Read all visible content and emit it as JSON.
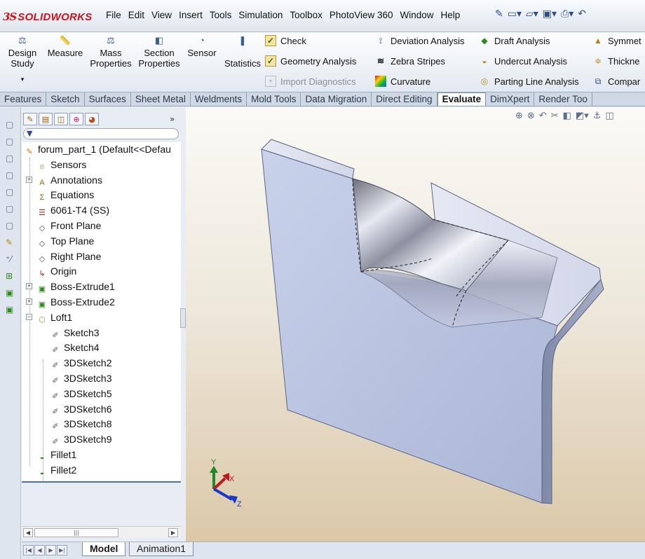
{
  "app": {
    "logo_mark": "3S",
    "logo_name": "SOLIDWORKS"
  },
  "menu": [
    "File",
    "Edit",
    "View",
    "Insert",
    "Tools",
    "Simulation",
    "Toolbox",
    "PhotoView 360",
    "Window",
    "Help"
  ],
  "ribbon": {
    "big_buttons": [
      {
        "label1": "Design",
        "label2": "Study",
        "icon": "design-study-icon"
      },
      {
        "label1": "Measure",
        "label2": "",
        "icon": "measure-icon"
      },
      {
        "label1": "Mass",
        "label2": "Properties",
        "icon": "mass-properties-icon"
      },
      {
        "label1": "Section",
        "label2": "Properties",
        "icon": "section-properties-icon"
      },
      {
        "label1": "Sensor",
        "label2": "",
        "icon": "sensor-icon"
      },
      {
        "label1": "Statistics",
        "label2": "",
        "icon": "statistics-icon"
      }
    ],
    "col1": [
      {
        "label": "Check",
        "enabled": true
      },
      {
        "label": "Geometry Analysis",
        "enabled": true
      },
      {
        "label": "Import Diagnostics",
        "enabled": false
      }
    ],
    "col2": [
      {
        "label": "Deviation Analysis"
      },
      {
        "label": "Zebra Stripes"
      },
      {
        "label": "Curvature"
      }
    ],
    "col3": [
      {
        "label": "Draft Analysis"
      },
      {
        "label": "Undercut Analysis"
      },
      {
        "label": "Parting Line Analysis"
      }
    ],
    "col4": [
      {
        "label": "Symmet"
      },
      {
        "label": "Thickne"
      },
      {
        "label": "Compar"
      }
    ]
  },
  "tabs": [
    "Features",
    "Sketch",
    "Surfaces",
    "Sheet Metal",
    "Weldments",
    "Mold Tools",
    "Data Migration",
    "Direct Editing",
    "Evaluate",
    "DimXpert",
    "Render Too"
  ],
  "active_tab": "Evaluate",
  "tree": {
    "root": "forum_part_1  (Default<<Defau",
    "items": [
      {
        "label": "Sensors",
        "icon": "sensors-icon",
        "level": 1,
        "expand": false
      },
      {
        "label": "Annotations",
        "icon": "annotations-icon",
        "level": 1,
        "expand": true
      },
      {
        "label": "Equations",
        "icon": "equations-icon",
        "level": 1,
        "expand": false
      },
      {
        "label": "6061-T4 (SS)",
        "icon": "material-icon",
        "level": 1,
        "expand": false
      },
      {
        "label": "Front Plane",
        "icon": "plane-icon",
        "level": 1,
        "expand": false
      },
      {
        "label": "Top Plane",
        "icon": "plane-icon",
        "level": 1,
        "expand": false
      },
      {
        "label": "Right Plane",
        "icon": "plane-icon",
        "level": 1,
        "expand": false
      },
      {
        "label": "Origin",
        "icon": "origin-icon",
        "level": 1,
        "expand": false
      },
      {
        "label": "Boss-Extrude1",
        "icon": "extrude-icon",
        "level": 1,
        "expand": true
      },
      {
        "label": "Boss-Extrude2",
        "icon": "extrude-icon",
        "level": 1,
        "expand": true
      },
      {
        "label": "Loft1",
        "icon": "loft-icon",
        "level": 1,
        "expand": true,
        "open": true
      },
      {
        "label": "Sketch3",
        "icon": "sketch-icon",
        "level": 2,
        "expand": false
      },
      {
        "label": "Sketch4",
        "icon": "sketch-icon",
        "level": 2,
        "expand": false
      },
      {
        "label": "3DSketch2",
        "icon": "3dsketch-icon",
        "level": 2,
        "expand": false
      },
      {
        "label": "3DSketch3",
        "icon": "3dsketch-icon",
        "level": 2,
        "expand": false
      },
      {
        "label": "3DSketch5",
        "icon": "3dsketch-icon",
        "level": 2,
        "expand": false
      },
      {
        "label": "3DSketch6",
        "icon": "3dsketch-icon",
        "level": 2,
        "expand": false
      },
      {
        "label": "3DSketch8",
        "icon": "3dsketch-icon",
        "level": 2,
        "expand": false
      },
      {
        "label": "3DSketch9",
        "icon": "3dsketch-icon",
        "level": 2,
        "expand": false
      },
      {
        "label": "Fillet1",
        "icon": "fillet-icon",
        "level": 1,
        "expand": false
      },
      {
        "label": "Fillet2",
        "icon": "fillet-icon",
        "level": 1,
        "expand": false
      }
    ]
  },
  "bottom_tabs": [
    "Model",
    "Animation1"
  ],
  "active_bottom_tab": "Model",
  "axes": {
    "x": "X",
    "y": "Y",
    "z": "Z"
  },
  "colors": {
    "brand_red": "#d0121b",
    "accent_blue": "#2a4c8a",
    "tree_end_line": "#4a72a8"
  }
}
